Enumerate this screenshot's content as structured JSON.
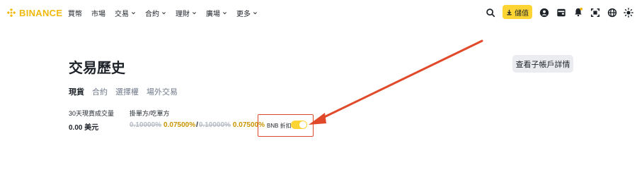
{
  "header": {
    "brand": "BINANCE",
    "nav": [
      {
        "label": "買幣",
        "dropdown": false
      },
      {
        "label": "市場",
        "dropdown": false
      },
      {
        "label": "交易",
        "dropdown": true
      },
      {
        "label": "合約",
        "dropdown": true
      },
      {
        "label": "理財",
        "dropdown": true
      },
      {
        "label": "廣場",
        "dropdown": true
      },
      {
        "label": "更多",
        "dropdown": true
      }
    ],
    "deposit_label": "儲值",
    "icons": [
      "search-icon",
      "download-icon",
      "account-icon",
      "wallet-icon",
      "notification-icon",
      "qr-download-icon",
      "language-globe-icon",
      "theme-toggle-icon"
    ]
  },
  "page": {
    "title": "交易歷史",
    "sub_account_button": "查看子帳戶詳情",
    "tabs": [
      {
        "label": "現貨",
        "active": true
      },
      {
        "label": "合約",
        "active": false
      },
      {
        "label": "選擇權",
        "active": false
      },
      {
        "label": "場外交易",
        "active": false
      }
    ]
  },
  "stats": {
    "volume_label": "30天現貨成交量",
    "volume_value": "0.00 美元",
    "fee_label": "掛單方/吃單方",
    "maker_old": "0.10000%",
    "maker_new": "0.07500%",
    "separator": "/",
    "taker_old": "0.10000%",
    "taker_new": "0.07500%"
  },
  "bnb_discount": {
    "label": "BNB 折扣",
    "enabled": true
  },
  "colors": {
    "brand_yellow": "#f0b90b",
    "button_yellow": "#fcd535",
    "fee_gold": "#c99400",
    "annotation_red": "#e04a2a"
  }
}
